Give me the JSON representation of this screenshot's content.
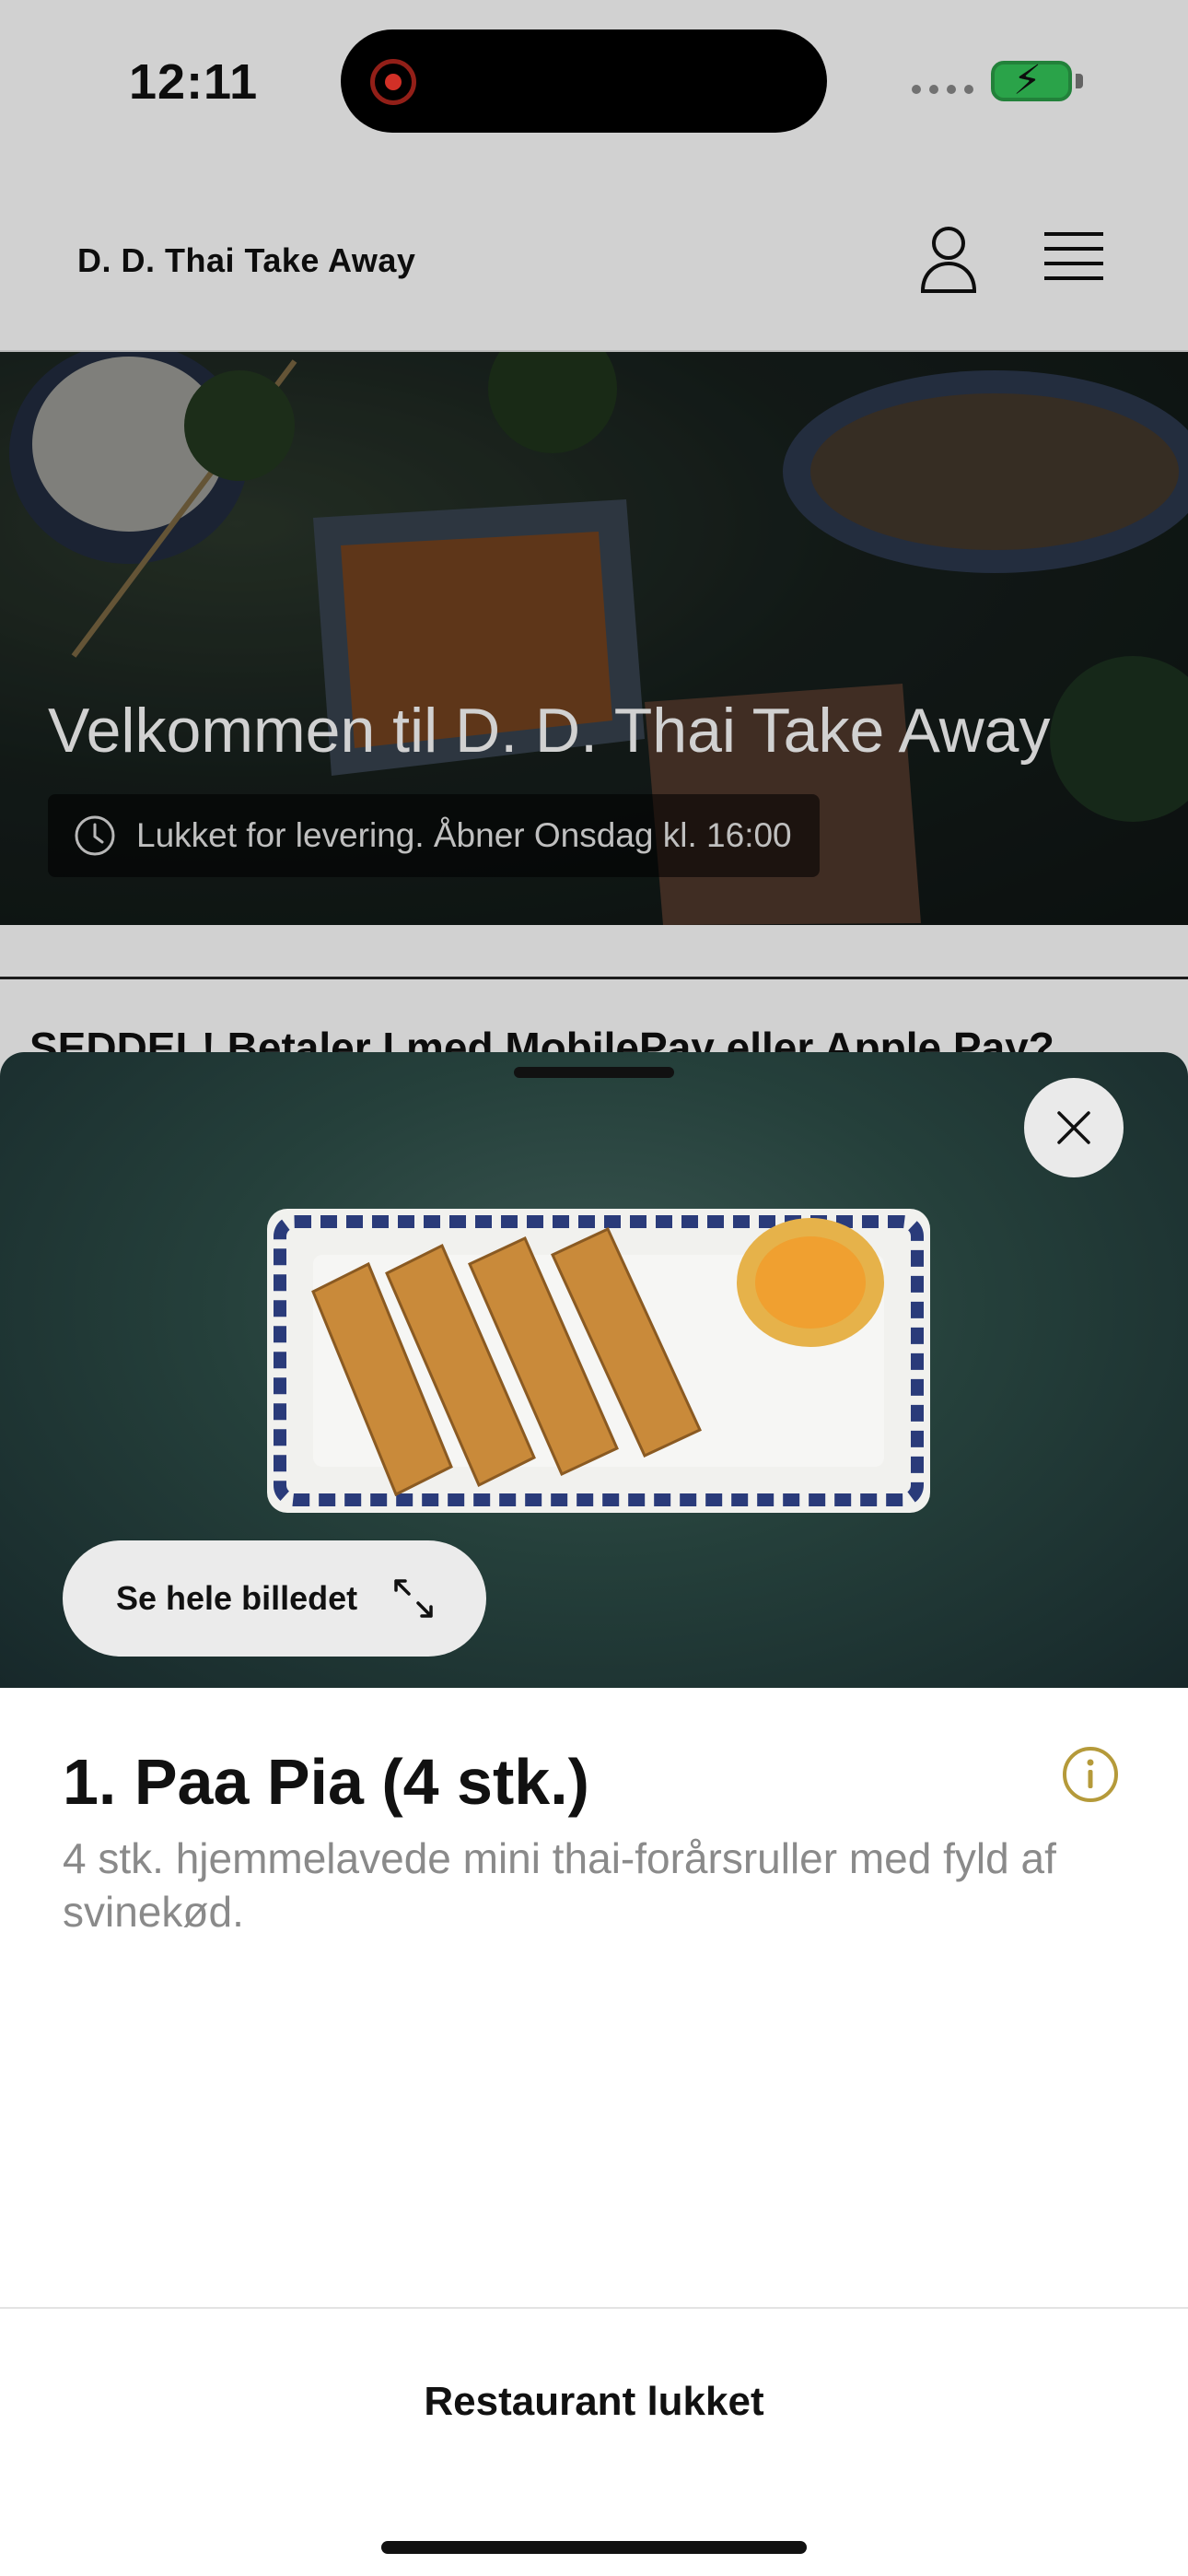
{
  "status_bar": {
    "time": "12:11"
  },
  "header": {
    "brand": "D. D. Thai Take Away"
  },
  "hero": {
    "title": "Velkommen til D. D. Thai Take Away",
    "status": "Lukket for levering. Åbner Onsdag kl. 16:00"
  },
  "notice": "SEDDEL! Betaler I med MobilePay eller Apple Pay?",
  "sheet": {
    "view_image_label": "Se hele billedet",
    "item_title": "1. Paa Pia (4 stk.)",
    "item_description": "4 stk. hjemmelavede mini thai-forårsruller med fyld af svinekød.",
    "footer_label": "Restaurant lukket"
  },
  "icons": {
    "user": "user-icon",
    "menu": "hamburger-menu-icon",
    "clock": "clock-icon",
    "close": "close-icon",
    "expand": "expand-icon",
    "info": "info-icon"
  },
  "colors": {
    "accent_info": "#b59a3a",
    "battery_green": "#34c759",
    "recording_red": "#ff3b30"
  }
}
